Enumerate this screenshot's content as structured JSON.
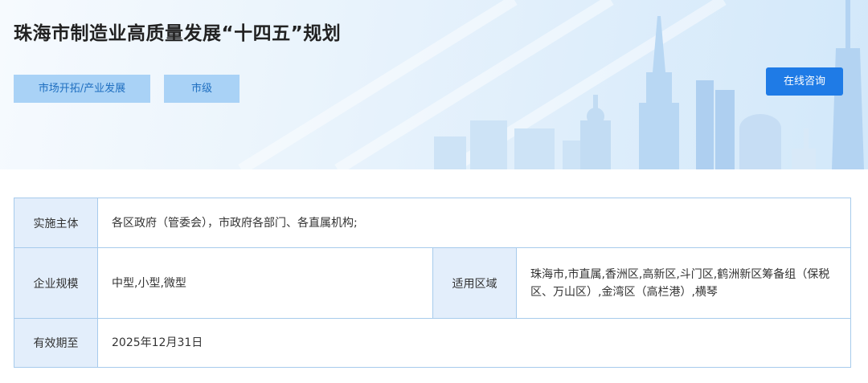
{
  "header": {
    "title": "珠海市制造业高质量发展“十四五”规划",
    "tags": [
      "市场开拓/产业发展",
      "市级"
    ],
    "consult_button": "在线咨询",
    "banner_icon": "city-skyline-illustration"
  },
  "details": {
    "implementer_label": "实施主体",
    "implementer_value": "各区政府（管委会），市政府各部门、各直属机构;",
    "company_size_label": "企业规模",
    "company_size_value": "中型,小型,微型",
    "region_label": "适用区域",
    "region_value": "珠海市,市直属,香洲区,高新区,斗门区,鹤洲新区筹备组（保税区、万山区）,金湾区（高栏港）,横琴",
    "validity_label": "有效期至",
    "validity_value": "2025年12月31日"
  },
  "colors": {
    "accent": "#1f7be6",
    "tag_bg": "#a9d2f6",
    "tag_text": "#1f6fc0",
    "label_bg": "#e3eefb",
    "border": "#a7cbec"
  }
}
